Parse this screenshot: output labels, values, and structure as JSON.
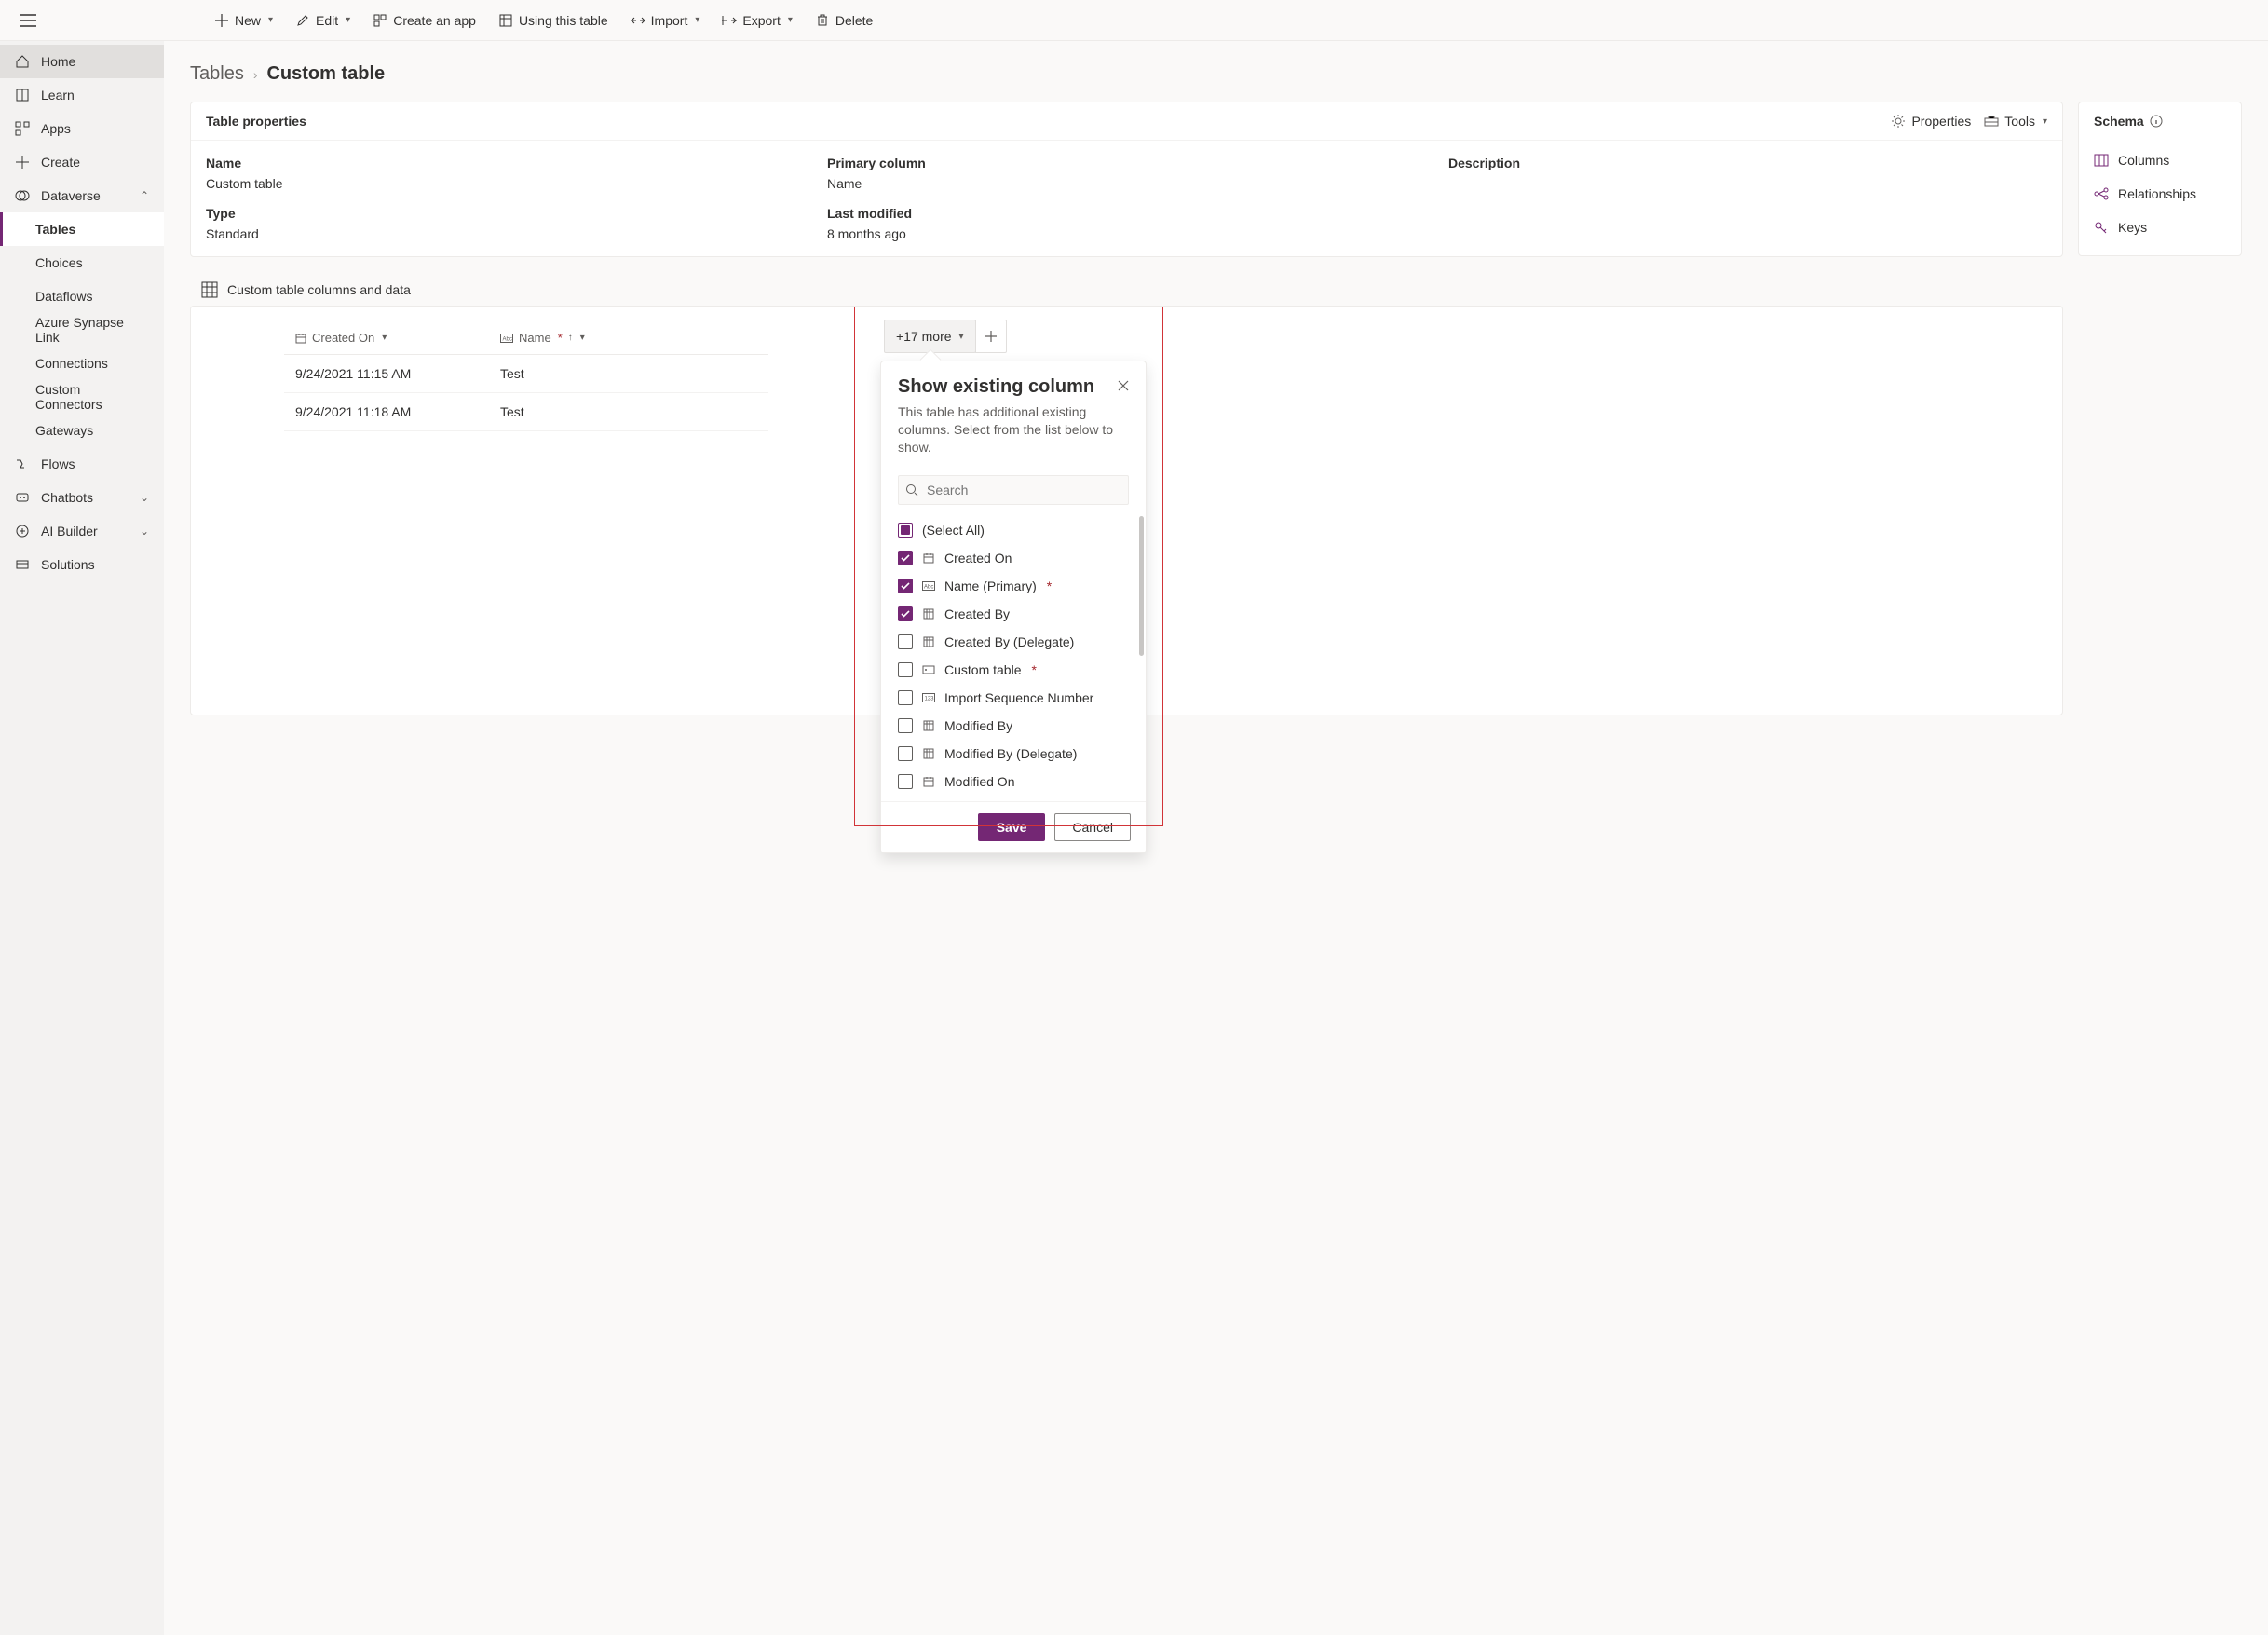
{
  "commands": {
    "new": "New",
    "edit": "Edit",
    "create_app": "Create an app",
    "using_table": "Using this table",
    "import": "Import",
    "export": "Export",
    "delete": "Delete"
  },
  "sidebar": {
    "home": "Home",
    "learn": "Learn",
    "apps": "Apps",
    "create": "Create",
    "dataverse": "Dataverse",
    "tables": "Tables",
    "choices": "Choices",
    "dataflows": "Dataflows",
    "synapse": "Azure Synapse Link",
    "connections": "Connections",
    "custom_connectors": "Custom Connectors",
    "gateways": "Gateways",
    "flows": "Flows",
    "chatbots": "Chatbots",
    "ai_builder": "AI Builder",
    "solutions": "Solutions"
  },
  "breadcrumb": {
    "root": "Tables",
    "current": "Custom table"
  },
  "table_props": {
    "card_title": "Table properties",
    "properties_btn": "Properties",
    "tools_btn": "Tools",
    "name_label": "Name",
    "name_value": "Custom table",
    "primary_label": "Primary column",
    "primary_value": "Name",
    "description_label": "Description",
    "description_value": "",
    "type_label": "Type",
    "type_value": "Standard",
    "last_modified_label": "Last modified",
    "last_modified_value": "8 months ago"
  },
  "schema": {
    "title": "Schema",
    "columns": "Columns",
    "relationships": "Relationships",
    "keys": "Keys"
  },
  "columns_section": {
    "title": "Custom table columns and data",
    "col_created_on": "Created On",
    "col_name": "Name",
    "more_label": "+17 more",
    "rows": [
      {
        "created": "9/24/2021 11:15 AM",
        "name": "Test"
      },
      {
        "created": "9/24/2021 11:18 AM",
        "name": "Test"
      }
    ]
  },
  "popover": {
    "title": "Show existing column",
    "desc": "This table has additional existing columns. Select from the list below to show.",
    "search_placeholder": "Search",
    "select_all": "(Select All)",
    "save": "Save",
    "cancel": "Cancel",
    "items": [
      {
        "label": "Created On",
        "checked": true,
        "icon": "date"
      },
      {
        "label": "Name (Primary)",
        "checked": true,
        "icon": "text",
        "required": true
      },
      {
        "label": "Created By",
        "checked": true,
        "icon": "lookup"
      },
      {
        "label": "Created By (Delegate)",
        "checked": false,
        "icon": "lookup"
      },
      {
        "label": "Custom table",
        "checked": false,
        "icon": "key",
        "required": true
      },
      {
        "label": "Import Sequence Number",
        "checked": false,
        "icon": "number"
      },
      {
        "label": "Modified By",
        "checked": false,
        "icon": "lookup"
      },
      {
        "label": "Modified By (Delegate)",
        "checked": false,
        "icon": "lookup"
      },
      {
        "label": "Modified On",
        "checked": false,
        "icon": "date"
      }
    ]
  }
}
